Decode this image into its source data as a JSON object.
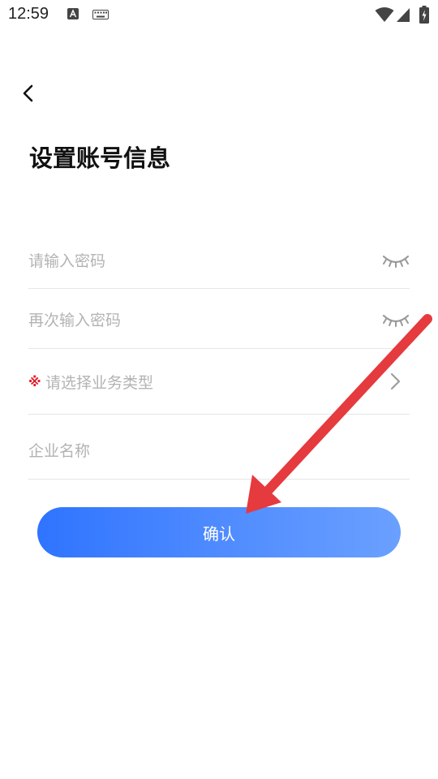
{
  "status_bar": {
    "time": "12:59",
    "icons": [
      "a-icon",
      "keyboard-icon",
      "wifi-icon",
      "signal-icon",
      "battery-icon"
    ]
  },
  "header": {
    "title": "设置账号信息"
  },
  "form": {
    "password_placeholder": "请输入密码",
    "confirm_password_placeholder": "再次输入密码",
    "required_mark": "※",
    "business_type_placeholder": "请选择业务类型",
    "company_name_placeholder": "企业名称"
  },
  "confirm_button": {
    "label": "确认"
  },
  "colors": {
    "button_gradient_start": "#2f74ff",
    "button_gradient_end": "#6aa0ff",
    "placeholder": "#b3b3b3",
    "required": "#e0202a",
    "annotation_arrow": "#e53a3e"
  }
}
